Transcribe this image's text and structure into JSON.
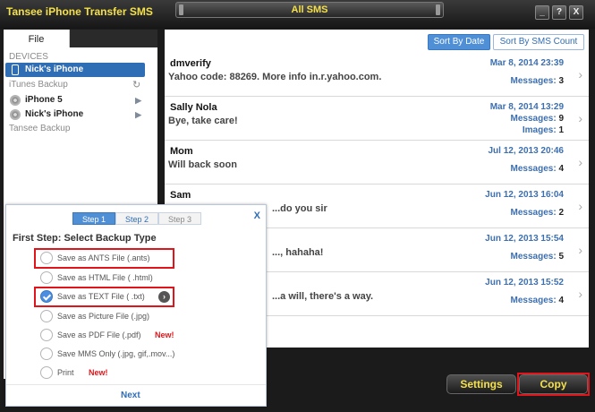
{
  "app": {
    "title": "Tansee iPhone Transfer SMS",
    "view_title": "All SMS",
    "window_buttons": {
      "minimize": "_",
      "help": "?",
      "close": "X"
    }
  },
  "sidebar": {
    "file_tab": "File",
    "devices_header": "DEVICES",
    "itunes_header": "iTunes Backup",
    "tansee_header": "Tansee Backup",
    "items": [
      {
        "label": "Nick's iPhone",
        "icon": "phone-icon",
        "selected": true
      },
      {
        "label": "iPhone 5",
        "icon": "disc-icon"
      },
      {
        "label": "Nick's iPhone",
        "icon": "disc-icon"
      }
    ]
  },
  "sort": {
    "by_date": "Sort By Date",
    "by_count": "Sort By SMS Count"
  },
  "messages": [
    {
      "name": "dmverify",
      "preview": "Yahoo code: 88269. More info in.r.yahoo.com.",
      "date": "Mar 8, 2014 23:39",
      "messages_label": "Messages:",
      "messages": "3"
    },
    {
      "name": "Sally Nola",
      "preview": "Bye, take care!",
      "date": "Mar 8, 2014 13:29",
      "messages_label": "Messages:",
      "messages": "9",
      "images_label": "Images:",
      "images": "1"
    },
    {
      "name": "Mom",
      "preview": "Will back soon",
      "date": "Jul 12, 2013 20:46",
      "messages_label": "Messages:",
      "messages": "4"
    },
    {
      "name": "Sam",
      "preview": "...do you sir",
      "date": "Jun 12, 2013 16:04",
      "messages_label": "Messages:",
      "messages": "2"
    },
    {
      "name": "",
      "preview": "..., hahaha!",
      "date": "Jun 12, 2013 15:54",
      "messages_label": "Messages:",
      "messages": "5"
    },
    {
      "name": "",
      "preview": "...a will, there's a way.",
      "date": "Jun 12, 2013 15:52",
      "messages_label": "Messages:",
      "messages": "4"
    }
  ],
  "dialog": {
    "steps": [
      "Step 1",
      "Step 2",
      "Step 3"
    ],
    "close": "X",
    "heading": "First Step: Select Backup Type",
    "options": [
      {
        "label": "Save as ANTS File (.ants)",
        "checked": false
      },
      {
        "label": "Save as HTML File ( .html)",
        "checked": false
      },
      {
        "label": "Save as TEXT File ( .txt)",
        "checked": true
      },
      {
        "label": "Save as Picture File (.jpg)",
        "checked": false
      },
      {
        "label": "Save as PDF File (.pdf)",
        "checked": false,
        "badge": "New!"
      },
      {
        "label": "Save MMS Only (.jpg, gif,.mov...)",
        "checked": false
      },
      {
        "label": "Print",
        "checked": false,
        "badge": "New!"
      }
    ],
    "next": "Next"
  },
  "bottom": {
    "settings": "Settings",
    "copy": "Copy"
  },
  "colors": {
    "accent_yellow": "#f4e04a",
    "selection_blue": "#2f6db5",
    "highlight_red": "#e0151b"
  }
}
